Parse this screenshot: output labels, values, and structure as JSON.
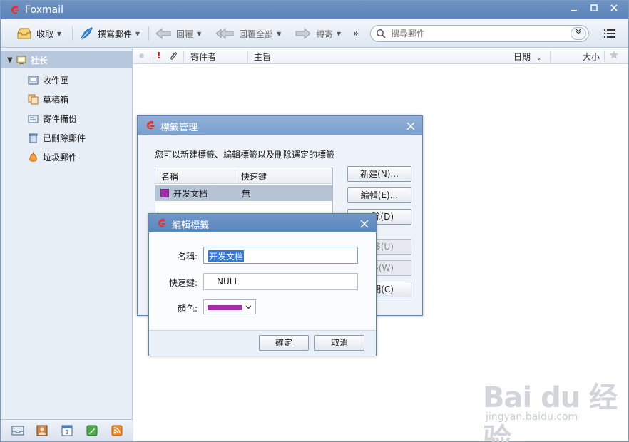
{
  "app": {
    "title": "Foxmail"
  },
  "colors": {
    "accent": "#6e93c2",
    "tag_color": "#a62ea6",
    "selection": "#3378d7"
  },
  "toolbar": {
    "receive": "收取",
    "compose": "撰寫郵件",
    "reply": "回覆",
    "reply_all": "回覆全部",
    "forward": "轉寄",
    "more": "»",
    "search_placeholder": "搜尋郵件"
  },
  "sidebar": {
    "account": "社长",
    "folders": [
      {
        "label": "收件匣",
        "icon": "inbox-icon"
      },
      {
        "label": "草稿箱",
        "icon": "drafts-icon"
      },
      {
        "label": "寄件備份",
        "icon": "sent-icon"
      },
      {
        "label": "已刪除郵件",
        "icon": "trash-icon"
      },
      {
        "label": "垃圾郵件",
        "icon": "junk-icon"
      }
    ],
    "bottom_tabs": [
      "mail-icon",
      "contacts-icon",
      "calendar-icon",
      "notes-icon",
      "rss-icon"
    ]
  },
  "list": {
    "columns": {
      "important": "!",
      "sender": "寄件者",
      "subject": "主旨",
      "date": "日期",
      "size": "大小"
    }
  },
  "tag_manager": {
    "title": "標籤管理",
    "description": "您可以新建標籤、編輯標籤以及刪除選定的標籤",
    "col_name": "名稱",
    "col_shortcut": "快速鍵",
    "rows": [
      {
        "name": "开发文档",
        "shortcut": "無"
      }
    ],
    "btn_new": "新建(N)...",
    "btn_edit": "編輯(E)...",
    "btn_delete_tail": "除(D)",
    "btn_moveup_tail": "移(U)",
    "btn_movedown_tail": "移(W)",
    "btn_close_tail": "閉(C)"
  },
  "edit_tag": {
    "title": "編輯標籤",
    "name_label": "名稱:",
    "name_value": "开发文档",
    "shortcut_label": "快速鍵:",
    "shortcut_value": "NULL",
    "color_label": "顏色:",
    "ok": "確定",
    "cancel": "取消"
  },
  "watermark": {
    "brand": "Bai du 经验",
    "url": "jingyan.baidu.com"
  }
}
